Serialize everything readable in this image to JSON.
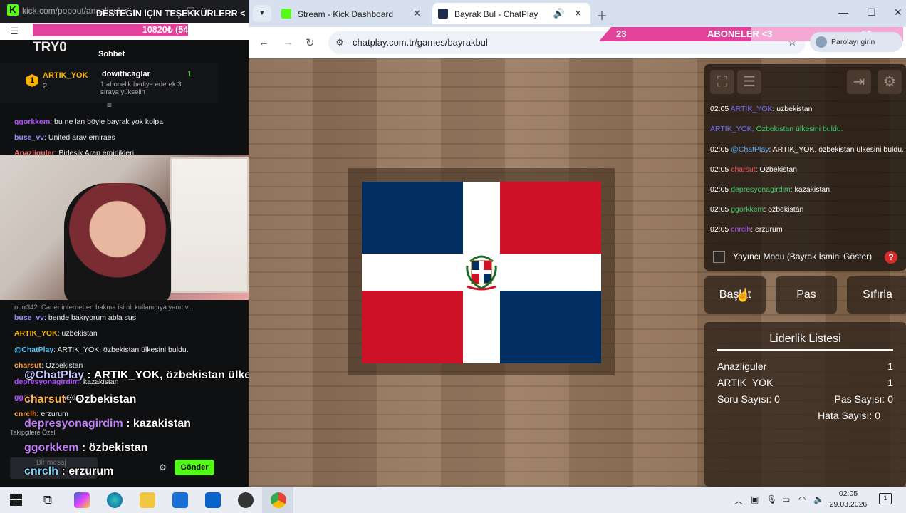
{
  "left": {
    "url": "kick.com/popout/anazliguler",
    "banner_text": "DESTEĞİN İÇİN TEŞEKKÜRLERR <",
    "progress_text": "10820₺ (54",
    "progress_fraction": 0.54,
    "subtitle": "TRY0",
    "chat_tab": "Sohbet",
    "gift": {
      "rank": "1",
      "rank_name": "ARTIK_YOK",
      "rank_count": "2",
      "gifter": "dowithcaglar",
      "gifter_count": "1",
      "note": "1 abonelik hediye ederek 3. sıraya yükselin"
    },
    "messages_top": [
      {
        "user": "ggorkkem",
        "color": "#b14cff",
        "text": ": bu ne lan böyle bayrak yok kolpa"
      },
      {
        "user": "buse_vv",
        "color": "#9b8bff",
        "text": ": United arav emiraes"
      },
      {
        "user": "Anazliguler",
        "color": "#ff6a6a",
        "text": ": Birleşik Arap emirlikleri"
      }
    ],
    "reply_note": "nurr342: Caner internetten bakma isimli kullanıcıya yanıt v...",
    "messages_bottom": [
      {
        "user": "buse_vv",
        "color": "#9b8bff",
        "text": ": bende bakıyorum abla sus"
      },
      {
        "user": "ARTIK_YOK",
        "color": "#f7b500",
        "text": ": uzbekistan"
      },
      {
        "user": "@ChatPlay",
        "color": "#53c6ff",
        "text": ": ARTIK_YOK, özbekistan ülkesini buldu."
      },
      {
        "user": "charsut",
        "color": "#ff9f43",
        "text": ": Ozbekistan"
      },
      {
        "user": "depresyonagirdim",
        "color": "#b14cff",
        "text": ": kazakistan"
      },
      {
        "user": "ggorkkem",
        "color": "#b14cff",
        "text": ": özbekistan"
      },
      {
        "user": "cnrclh",
        "color": "#ff9f43",
        "text": ": erzurum"
      }
    ],
    "overlay": [
      {
        "user": "@ChatPlay",
        "color": "#c7c7ff",
        "text": " : ARTIK_YOK, özbekistan ülkesini buldu."
      },
      {
        "user": "charsut",
        "color": "#ffb347",
        "text": " : Ozbekistan"
      },
      {
        "user": "depresyonagirdim",
        "color": "#c77dff",
        "text": " : kazakistan"
      },
      {
        "user": "ggorkkem",
        "color": "#c77dff",
        "text": " : özbekistan"
      },
      {
        "user": "cnrclh",
        "color": "#7ad7ff",
        "text": " : erzurum"
      }
    ],
    "followers_note": "Takipçilere Özel",
    "input_placeholder": "Bir mesaj",
    "send_label": "Gönder"
  },
  "browser": {
    "tabs": [
      {
        "title": "Stream - Kick Dashboard",
        "favicon_color": "#53fc18",
        "active": false
      },
      {
        "title": "Bayrak Bul - ChatPlay",
        "favicon_color": "#1e2b4a",
        "active": true
      }
    ],
    "url": "chatplay.com.tr/games/bayrakbul",
    "profile": "Parolayı girin",
    "overlay_bar": {
      "left": "23",
      "center": "ABONELER <3",
      "right": "50"
    }
  },
  "game": {
    "flag": "Dominican Republic",
    "log": [
      {
        "time": "02:05",
        "user": "ARTIK_YOK",
        "color": "#6f6fff",
        "text": ": uzbekistan"
      },
      {
        "time": "",
        "user": "ARTIK_YOK,",
        "color": "#6f6fff",
        "text": " Özbekistan ülkesini buldu.",
        "text_color": "#3ecf6b"
      },
      {
        "time": "02:05",
        "user": "@ChatPlay",
        "color": "#5ab0ff",
        "text": ": ARTIK_YOK, özbekistan ülkesini buldu."
      },
      {
        "time": "02:05",
        "user": "charsut",
        "color": "#ff4d4d",
        "text": ": Ozbekistan"
      },
      {
        "time": "02:05",
        "user": "depresyonagirdim",
        "color": "#3ecf6b",
        "text": ": kazakistan"
      },
      {
        "time": "02:05",
        "user": "ggorkkem",
        "color": "#3ecf6b",
        "text": ": özbekistan"
      },
      {
        "time": "02:05",
        "user": "cnrclh",
        "color": "#b14cff",
        "text": ": erzurum"
      }
    ],
    "streamer_mode_label": "Yayıncı Modu (Bayrak İsmini Göster)",
    "help": "?",
    "buttons": {
      "start": "Başlat",
      "pass": "Pas",
      "reset": "Sıfırla"
    },
    "leaderboard": {
      "title": "Liderlik Listesi",
      "rows": [
        {
          "name": "Anazliguler",
          "value": "1"
        },
        {
          "name": "ARTIK_YOK",
          "value": "1"
        }
      ],
      "questions": "Soru Sayısı: 0",
      "passes": "Pas Sayısı: 0",
      "errors": "Hata Sayısı: 0"
    }
  },
  "taskbar": {
    "time": "02:05",
    "date": "29.03.2026",
    "notifications": "1"
  }
}
